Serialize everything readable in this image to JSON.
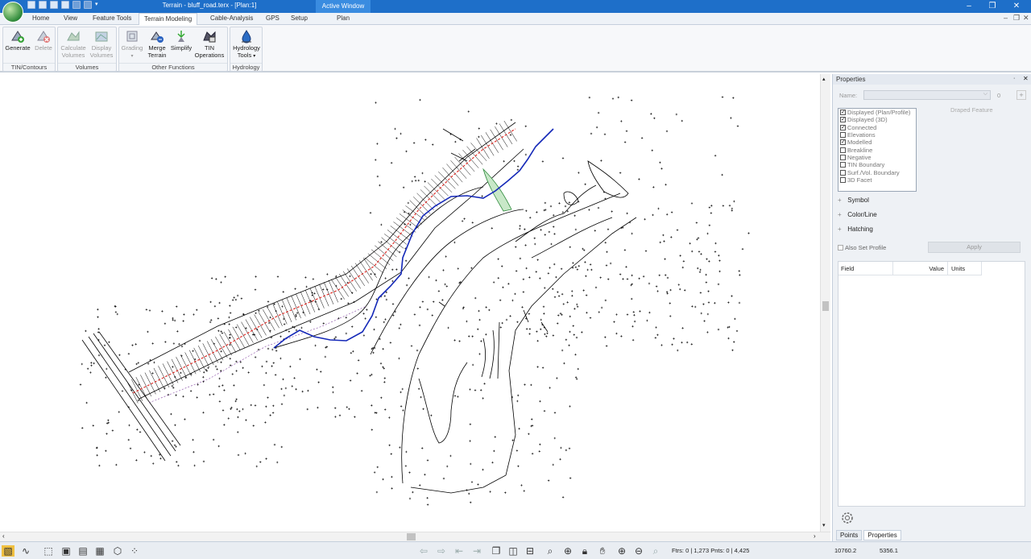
{
  "window": {
    "title": "Terrain - bluff_road.terx - [Plan:1]",
    "active_window_label": "Active Window"
  },
  "menu_tabs": [
    "Home",
    "View",
    "Feature Tools",
    "Terrain Modeling",
    "Cable-Analysis",
    "GPS",
    "Setup",
    "Plan"
  ],
  "active_tab": "Terrain Modeling",
  "ribbon": {
    "groups": [
      {
        "label": "TIN/Contours",
        "buttons": [
          {
            "label": "Generate",
            "enabled": true,
            "icon": "generate-tin-icon"
          },
          {
            "label": "Delete",
            "enabled": false,
            "icon": "delete-tin-icon"
          }
        ]
      },
      {
        "label": "Volumes",
        "buttons": [
          {
            "label": "Calculate Volumes",
            "enabled": false,
            "icon": "calculate-volumes-icon"
          },
          {
            "label": "Display Volumes",
            "enabled": false,
            "icon": "display-volumes-icon"
          }
        ]
      },
      {
        "label": "Other Functions",
        "buttons": [
          {
            "label": "Grading",
            "enabled": false,
            "icon": "grading-icon"
          },
          {
            "label": "Merge Terrain",
            "enabled": true,
            "icon": "merge-terrain-icon"
          },
          {
            "label": "Simplify",
            "enabled": true,
            "icon": "simplify-icon"
          },
          {
            "label": "TIN Operations",
            "enabled": true,
            "icon": "tin-operations-icon"
          }
        ]
      },
      {
        "label": "Hydrology",
        "buttons": [
          {
            "label": "Hydrology Tools",
            "enabled": true,
            "icon": "hydrology-icon"
          }
        ]
      }
    ]
  },
  "properties": {
    "title": "Properties",
    "name_label": "Name:",
    "name_value": "",
    "count_value": "0",
    "draped_label": "Draped Feature",
    "checkboxes": [
      {
        "label": "Displayed (Plan/Profile)",
        "checked": true
      },
      {
        "label": "Displayed (3D)",
        "checked": true
      },
      {
        "label": "Connected",
        "checked": true
      },
      {
        "label": "Elevations",
        "checked": false
      },
      {
        "label": "Modelled",
        "checked": true
      },
      {
        "label": "Breakline",
        "checked": false
      },
      {
        "label": "Negative",
        "checked": false
      },
      {
        "label": "TIN Boundary",
        "checked": false
      },
      {
        "label": "Surf./Vol. Boundary",
        "checked": false
      },
      {
        "label": "3D Facet",
        "checked": false
      }
    ],
    "sections": [
      "Symbol",
      "Color/Line",
      "Hatching"
    ],
    "also_set_profile": "Also Set Profile",
    "apply_label": "Apply",
    "grid_headers": [
      "Field",
      "Value",
      "Units"
    ],
    "bottom_tabs": [
      "Points",
      "Properties"
    ],
    "active_bottom_tab": "Properties"
  },
  "status": {
    "ftrs_pnts": "Ftrs: 0 | 1,273  Pnts: 0 | 4,425",
    "x_coord": "10760.2",
    "y_coord": "5356.1"
  },
  "colors": {
    "accent": "#1e6fc9",
    "road_centerline": "#e0302a",
    "stream": "#1428b8",
    "feature_green": "#2e8b3c"
  }
}
